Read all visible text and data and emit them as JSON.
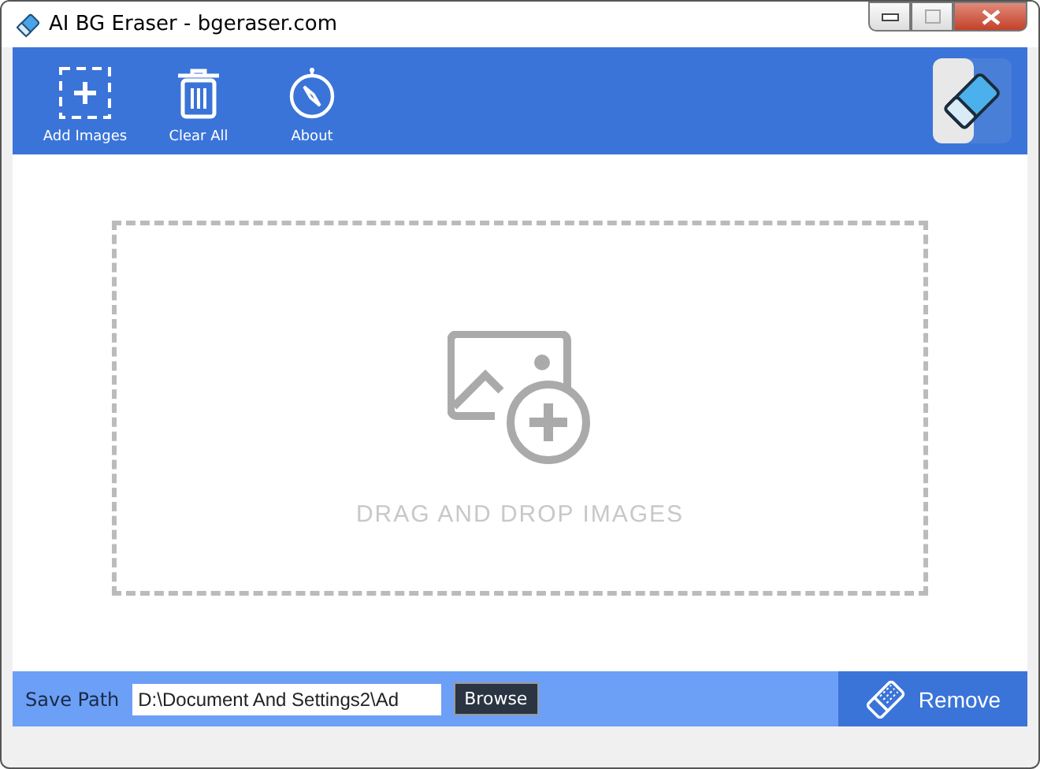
{
  "window": {
    "title": "AI BG Eraser - bgeraser.com"
  },
  "toolbar": [
    {
      "kind": "add",
      "label": "Add Images"
    },
    {
      "kind": "trash",
      "label": "Clear All"
    },
    {
      "kind": "compass",
      "label": "About"
    }
  ],
  "drop_zone": {
    "text": "DRAG AND DROP IMAGES"
  },
  "footer": {
    "save_path_label": "Save Path",
    "save_path_value": "D:\\Document And Settings2\\Ad",
    "browse_button": "Browse",
    "remove_button": "Remove"
  }
}
